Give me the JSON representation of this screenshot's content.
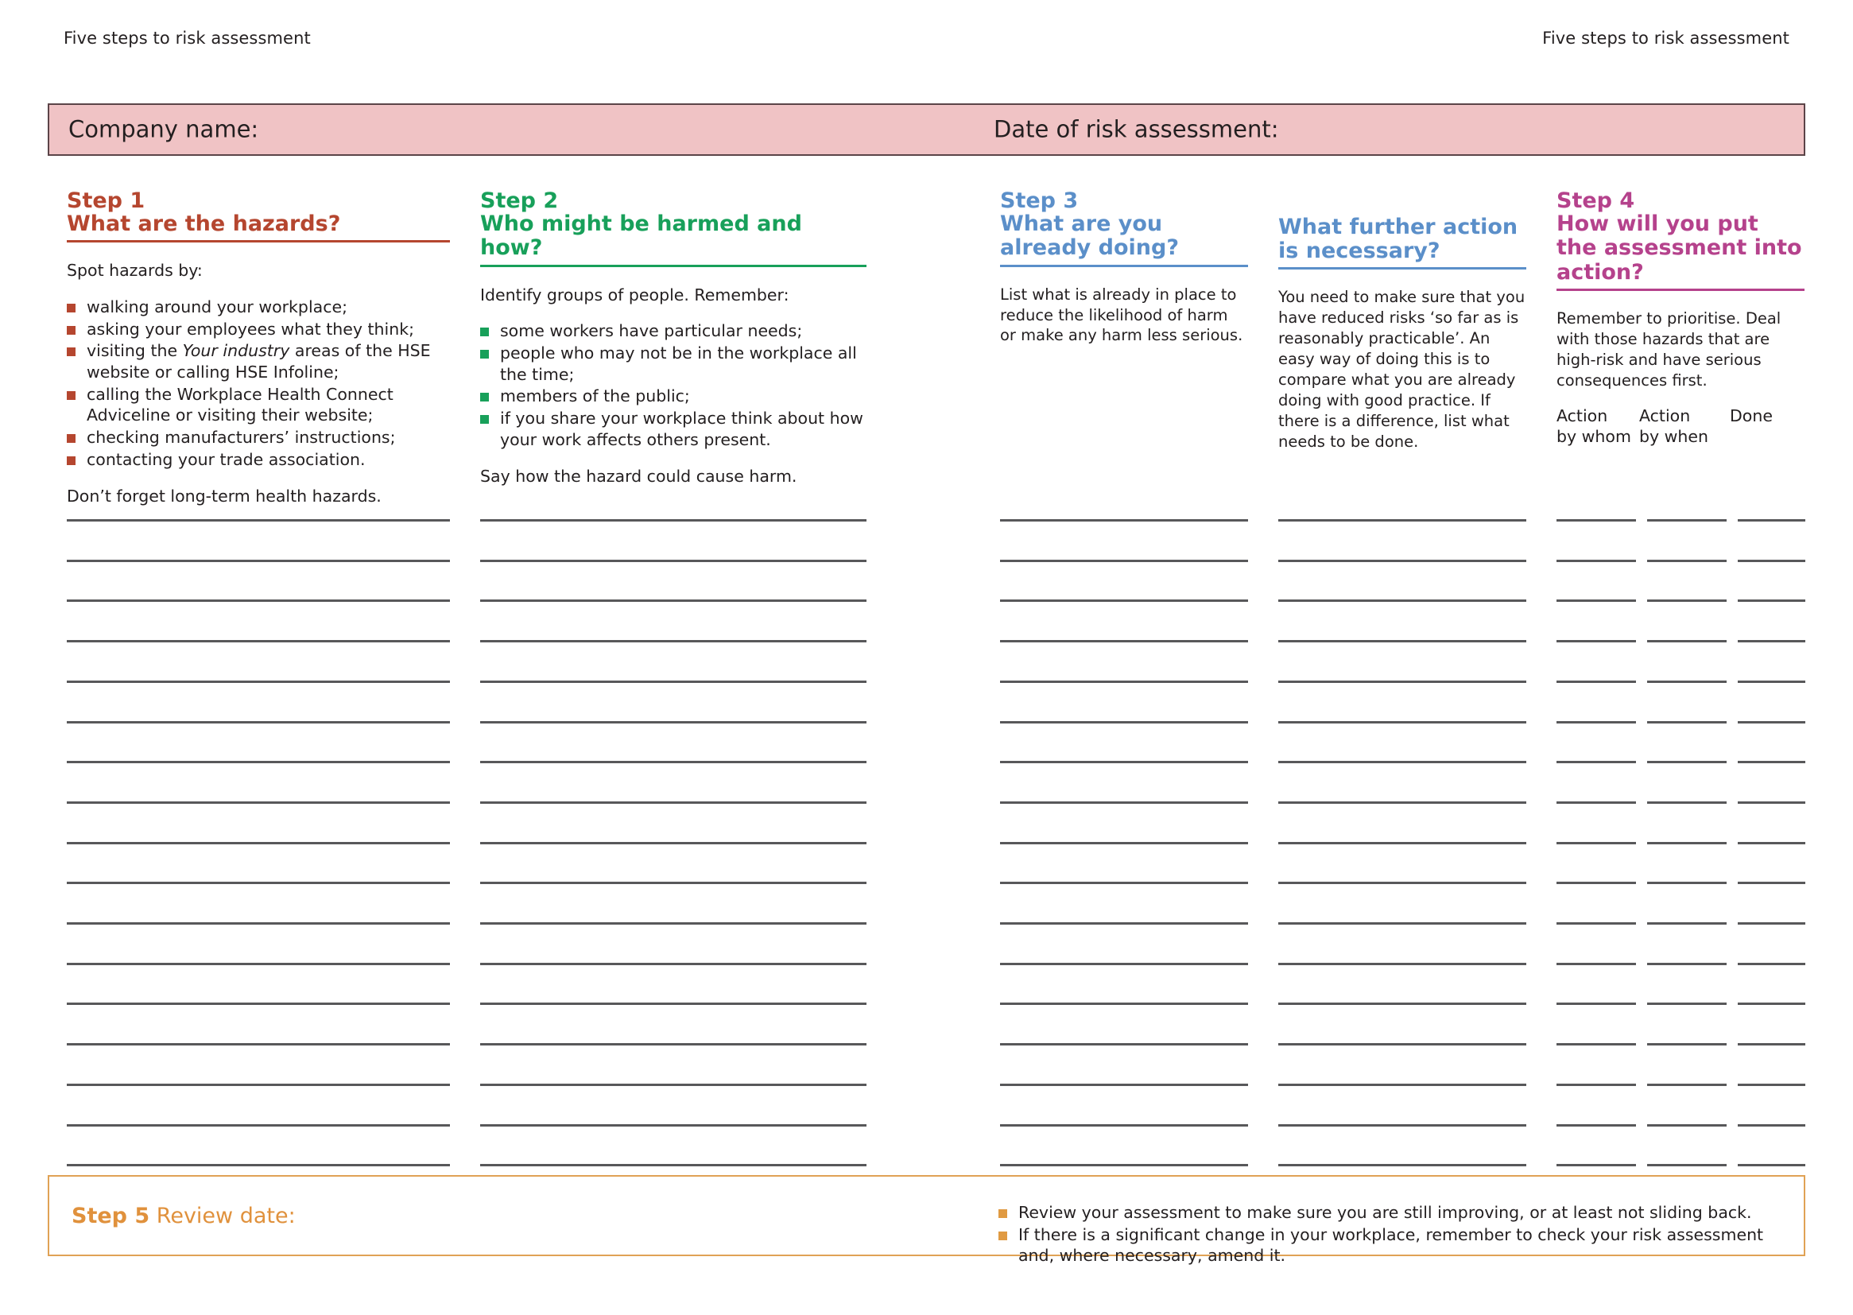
{
  "running_head": {
    "left": "Five steps to risk assessment",
    "right": "Five steps to risk assessment"
  },
  "banner": {
    "company_label": "Company name:",
    "date_label": "Date of risk assessment:",
    "background_color": "#f0c3c5",
    "border_color": "#5b4448"
  },
  "steps": {
    "step1": {
      "label": "Step 1",
      "question": "What are the hazards?",
      "accent_color": "#b5462f",
      "intro": "Spot hazards by:",
      "bullets": [
        {
          "pre": "walking around your workplace;",
          "italic": "",
          "post": ""
        },
        {
          "pre": "asking your employees what they think;",
          "italic": "",
          "post": ""
        },
        {
          "pre": "visiting the ",
          "italic": "Your industry",
          "post": " areas of the HSE website or calling HSE Infoline;"
        },
        {
          "pre": "calling the Workplace Health Connect Adviceline or visiting their website;",
          "italic": "",
          "post": ""
        },
        {
          "pre": "checking manufacturers’ instructions;",
          "italic": "",
          "post": ""
        },
        {
          "pre": "contacting your trade association.",
          "italic": "",
          "post": ""
        }
      ],
      "outro": "Don’t forget long-term health hazards."
    },
    "step2": {
      "label": "Step 2",
      "question": "Who might be harmed and how?",
      "accent_color": "#18a05a",
      "intro": "Identify groups of people. Remember:",
      "bullets": [
        "some workers have particular needs;",
        "people who may not be in the workplace all the time;",
        "members of the public;",
        "if you share your workplace think about how your work affects others present."
      ],
      "outro": "Say how the hazard could cause harm."
    },
    "step3": {
      "label": "Step 3",
      "question": "What are you already doing?",
      "accent_color": "#5b8fc9",
      "body": "List what is already in place to reduce the likelihood of harm or make any harm less serious."
    },
    "step3b": {
      "question": "What further action is necessary?",
      "accent_color": "#5b8fc9",
      "body": "You need to make sure that you have reduced risks ‘so far as is reasonably practicable’. An easy way of doing this is to compare what you are already doing with good practice. If there is a difference, list what needs to be done."
    },
    "step4": {
      "label": "Step 4",
      "question": "How will you put the assessment into action?",
      "accent_color": "#b5428c",
      "body": "Remember to prioritise. Deal with those hazards that are high-risk and have serious consequences first.",
      "action_headings": [
        "Action\nby whom",
        "Action\nby when",
        "Done"
      ]
    },
    "step5": {
      "label": "Step 5",
      "review_label": "Review date:",
      "accent_color": "#e0913c",
      "bullets": [
        "Review your assessment to make sure you are still improving, or at least not sliding back.",
        "If there is a significant change in your workplace, remember to check your risk assessment and, where necessary, amend it."
      ]
    }
  },
  "writing_lines": {
    "count": 17,
    "line_color": "#58585a"
  }
}
